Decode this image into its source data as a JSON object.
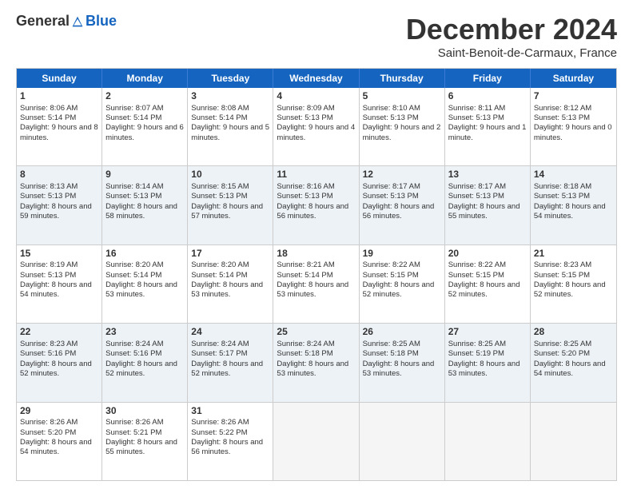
{
  "logo": {
    "general": "General",
    "blue": "Blue"
  },
  "title": "December 2024",
  "subtitle": "Saint-Benoit-de-Carmaux, France",
  "header_days": [
    "Sunday",
    "Monday",
    "Tuesday",
    "Wednesday",
    "Thursday",
    "Friday",
    "Saturday"
  ],
  "rows": [
    [
      {
        "day": "1",
        "sunrise": "Sunrise: 8:06 AM",
        "sunset": "Sunset: 5:14 PM",
        "daylight": "Daylight: 9 hours and 8 minutes."
      },
      {
        "day": "2",
        "sunrise": "Sunrise: 8:07 AM",
        "sunset": "Sunset: 5:14 PM",
        "daylight": "Daylight: 9 hours and 6 minutes."
      },
      {
        "day": "3",
        "sunrise": "Sunrise: 8:08 AM",
        "sunset": "Sunset: 5:14 PM",
        "daylight": "Daylight: 9 hours and 5 minutes."
      },
      {
        "day": "4",
        "sunrise": "Sunrise: 8:09 AM",
        "sunset": "Sunset: 5:13 PM",
        "daylight": "Daylight: 9 hours and 4 minutes."
      },
      {
        "day": "5",
        "sunrise": "Sunrise: 8:10 AM",
        "sunset": "Sunset: 5:13 PM",
        "daylight": "Daylight: 9 hours and 2 minutes."
      },
      {
        "day": "6",
        "sunrise": "Sunrise: 8:11 AM",
        "sunset": "Sunset: 5:13 PM",
        "daylight": "Daylight: 9 hours and 1 minute."
      },
      {
        "day": "7",
        "sunrise": "Sunrise: 8:12 AM",
        "sunset": "Sunset: 5:13 PM",
        "daylight": "Daylight: 9 hours and 0 minutes."
      }
    ],
    [
      {
        "day": "8",
        "sunrise": "Sunrise: 8:13 AM",
        "sunset": "Sunset: 5:13 PM",
        "daylight": "Daylight: 8 hours and 59 minutes."
      },
      {
        "day": "9",
        "sunrise": "Sunrise: 8:14 AM",
        "sunset": "Sunset: 5:13 PM",
        "daylight": "Daylight: 8 hours and 58 minutes."
      },
      {
        "day": "10",
        "sunrise": "Sunrise: 8:15 AM",
        "sunset": "Sunset: 5:13 PM",
        "daylight": "Daylight: 8 hours and 57 minutes."
      },
      {
        "day": "11",
        "sunrise": "Sunrise: 8:16 AM",
        "sunset": "Sunset: 5:13 PM",
        "daylight": "Daylight: 8 hours and 56 minutes."
      },
      {
        "day": "12",
        "sunrise": "Sunrise: 8:17 AM",
        "sunset": "Sunset: 5:13 PM",
        "daylight": "Daylight: 8 hours and 56 minutes."
      },
      {
        "day": "13",
        "sunrise": "Sunrise: 8:17 AM",
        "sunset": "Sunset: 5:13 PM",
        "daylight": "Daylight: 8 hours and 55 minutes."
      },
      {
        "day": "14",
        "sunrise": "Sunrise: 8:18 AM",
        "sunset": "Sunset: 5:13 PM",
        "daylight": "Daylight: 8 hours and 54 minutes."
      }
    ],
    [
      {
        "day": "15",
        "sunrise": "Sunrise: 8:19 AM",
        "sunset": "Sunset: 5:13 PM",
        "daylight": "Daylight: 8 hours and 54 minutes."
      },
      {
        "day": "16",
        "sunrise": "Sunrise: 8:20 AM",
        "sunset": "Sunset: 5:14 PM",
        "daylight": "Daylight: 8 hours and 53 minutes."
      },
      {
        "day": "17",
        "sunrise": "Sunrise: 8:20 AM",
        "sunset": "Sunset: 5:14 PM",
        "daylight": "Daylight: 8 hours and 53 minutes."
      },
      {
        "day": "18",
        "sunrise": "Sunrise: 8:21 AM",
        "sunset": "Sunset: 5:14 PM",
        "daylight": "Daylight: 8 hours and 53 minutes."
      },
      {
        "day": "19",
        "sunrise": "Sunrise: 8:22 AM",
        "sunset": "Sunset: 5:15 PM",
        "daylight": "Daylight: 8 hours and 52 minutes."
      },
      {
        "day": "20",
        "sunrise": "Sunrise: 8:22 AM",
        "sunset": "Sunset: 5:15 PM",
        "daylight": "Daylight: 8 hours and 52 minutes."
      },
      {
        "day": "21",
        "sunrise": "Sunrise: 8:23 AM",
        "sunset": "Sunset: 5:15 PM",
        "daylight": "Daylight: 8 hours and 52 minutes."
      }
    ],
    [
      {
        "day": "22",
        "sunrise": "Sunrise: 8:23 AM",
        "sunset": "Sunset: 5:16 PM",
        "daylight": "Daylight: 8 hours and 52 minutes."
      },
      {
        "day": "23",
        "sunrise": "Sunrise: 8:24 AM",
        "sunset": "Sunset: 5:16 PM",
        "daylight": "Daylight: 8 hours and 52 minutes."
      },
      {
        "day": "24",
        "sunrise": "Sunrise: 8:24 AM",
        "sunset": "Sunset: 5:17 PM",
        "daylight": "Daylight: 8 hours and 52 minutes."
      },
      {
        "day": "25",
        "sunrise": "Sunrise: 8:24 AM",
        "sunset": "Sunset: 5:18 PM",
        "daylight": "Daylight: 8 hours and 53 minutes."
      },
      {
        "day": "26",
        "sunrise": "Sunrise: 8:25 AM",
        "sunset": "Sunset: 5:18 PM",
        "daylight": "Daylight: 8 hours and 53 minutes."
      },
      {
        "day": "27",
        "sunrise": "Sunrise: 8:25 AM",
        "sunset": "Sunset: 5:19 PM",
        "daylight": "Daylight: 8 hours and 53 minutes."
      },
      {
        "day": "28",
        "sunrise": "Sunrise: 8:25 AM",
        "sunset": "Sunset: 5:20 PM",
        "daylight": "Daylight: 8 hours and 54 minutes."
      }
    ],
    [
      {
        "day": "29",
        "sunrise": "Sunrise: 8:26 AM",
        "sunset": "Sunset: 5:20 PM",
        "daylight": "Daylight: 8 hours and 54 minutes."
      },
      {
        "day": "30",
        "sunrise": "Sunrise: 8:26 AM",
        "sunset": "Sunset: 5:21 PM",
        "daylight": "Daylight: 8 hours and 55 minutes."
      },
      {
        "day": "31",
        "sunrise": "Sunrise: 8:26 AM",
        "sunset": "Sunset: 5:22 PM",
        "daylight": "Daylight: 8 hours and 56 minutes."
      },
      null,
      null,
      null,
      null
    ]
  ]
}
